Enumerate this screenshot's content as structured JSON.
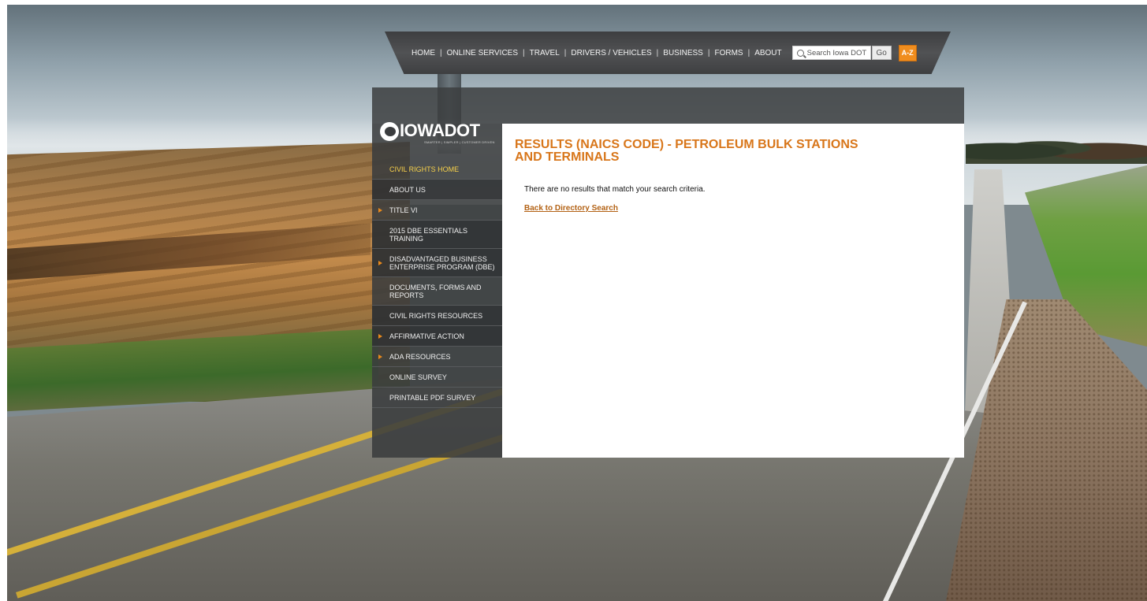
{
  "topnav": {
    "links": [
      "HOME",
      "ONLINE SERVICES",
      "TRAVEL",
      "DRIVERS / VEHICLES",
      "BUSINESS",
      "FORMS",
      "ABOUT"
    ],
    "separator": "|",
    "search_placeholder": "Search Iowa DOT",
    "go_label": "Go",
    "az_label": "A-Z"
  },
  "logo": {
    "text": "IOWADOT",
    "tagline": "SMARTER | SIMPLER | CUSTOMER DRIVEN"
  },
  "sidebar": {
    "items": [
      {
        "label": "CIVIL RIGHTS HOME",
        "active": true,
        "arrow": false
      },
      {
        "label": "ABOUT US",
        "active": false,
        "arrow": false
      },
      {
        "label": "TITLE VI",
        "active": false,
        "arrow": true
      },
      {
        "label": "2015 DBE ESSENTIALS TRAINING",
        "active": false,
        "arrow": false
      },
      {
        "label": "DISADVANTAGED BUSINESS ENTERPRISE PROGRAM (DBE)",
        "active": false,
        "arrow": true
      },
      {
        "label": "DOCUMENTS, FORMS AND REPORTS",
        "active": false,
        "arrow": false
      },
      {
        "label": "CIVIL RIGHTS RESOURCES",
        "active": false,
        "arrow": false
      },
      {
        "label": "AFFIRMATIVE ACTION",
        "active": false,
        "arrow": true
      },
      {
        "label": "ADA RESOURCES",
        "active": false,
        "arrow": true
      },
      {
        "label": "ONLINE SURVEY",
        "active": false,
        "arrow": false
      },
      {
        "label": "PRINTABLE PDF SURVEY",
        "active": false,
        "arrow": false
      }
    ]
  },
  "main": {
    "title": "RESULTS (NAICS CODE) - PETROLEUM BULK STATIONS AND TERMINALS",
    "message": "There are no results that match your search criteria.",
    "back_link": "Back to Directory Search"
  },
  "colors": {
    "title_orange": "#d8761a",
    "link_brown": "#b36215",
    "active_yellow": "#f7d14a",
    "arrow_orange": "#e8891c",
    "az_orange": "#f08d1e"
  }
}
